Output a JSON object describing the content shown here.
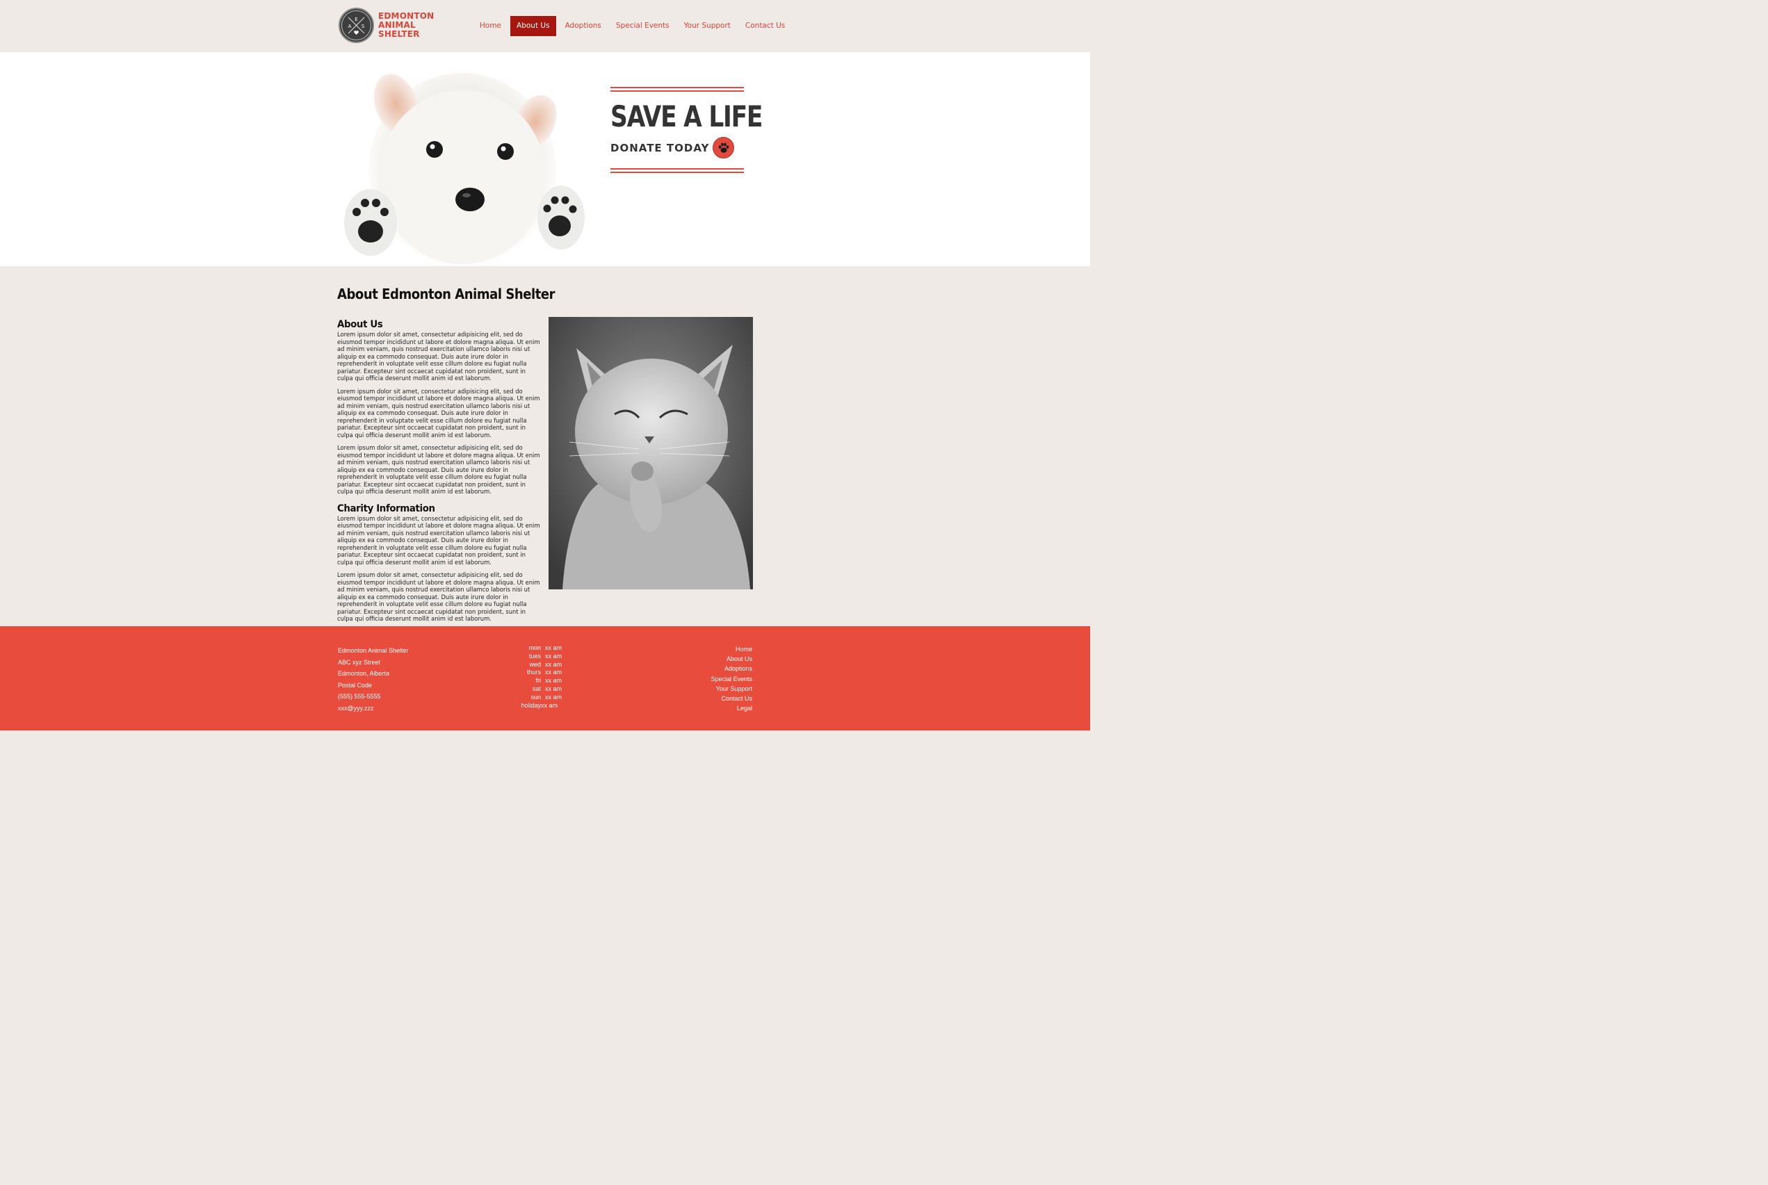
{
  "header": {
    "logo": {
      "badge_letters": [
        "E",
        "A",
        "S"
      ],
      "lines": [
        "EDMONTON",
        "ANIMAL",
        "SHELTER"
      ]
    },
    "nav": [
      {
        "label": "Home",
        "active": false
      },
      {
        "label": "About Us",
        "active": true
      },
      {
        "label": "Adoptions",
        "active": false
      },
      {
        "label": "Special Events",
        "active": false
      },
      {
        "label": "Your Support",
        "active": false
      },
      {
        "label": "Contact Us",
        "active": false
      }
    ]
  },
  "hero": {
    "title": "SAVE A LIFE",
    "cta": "DONATE TODAY",
    "cta_icon": "paw-icon"
  },
  "about": {
    "title": "About Edmonton Animal Shelter",
    "sections": [
      {
        "heading": "About Us",
        "paragraphs": [
          "Lorem ipsum dolor sit amet, consectetur adipisicing elit, sed do eiusmod tempor incididunt ut labore et dolore magna aliqua. Ut enim ad minim veniam, quis nostrud exercitation ullamco laboris nisi ut aliquip ex ea commodo consequat. Duis aute irure dolor in reprehenderit in voluptate velit esse cillum dolore eu fugiat nulla pariatur. Excepteur sint occaecat cupidatat non proident, sunt in culpa qui officia deserunt mollit anim id est laborum.",
          "Lorem ipsum dolor sit amet, consectetur adipisicing elit, sed do eiusmod tempor incididunt ut labore et dolore magna aliqua. Ut enim ad minim veniam, quis nostrud exercitation ullamco laboris nisi ut aliquip ex ea commodo consequat. Duis aute irure dolor in reprehenderit in voluptate velit esse cillum dolore eu fugiat nulla pariatur. Excepteur sint occaecat cupidatat non proident, sunt in culpa qui officia deserunt mollit anim id est laborum.",
          "Lorem ipsum dolor sit amet, consectetur adipisicing elit, sed do eiusmod tempor incididunt ut labore et dolore magna aliqua. Ut enim ad minim veniam, quis nostrud exercitation ullamco laboris nisi ut aliquip ex ea commodo consequat. Duis aute irure dolor in reprehenderit in voluptate velit esse cillum dolore eu fugiat nulla pariatur. Excepteur sint occaecat cupidatat non proident, sunt in culpa qui officia deserunt mollit anim id est laborum."
        ]
      },
      {
        "heading": "Charity Information",
        "paragraphs": [
          "Lorem ipsum dolor sit amet, consectetur adipisicing elit, sed do eiusmod tempor incididunt ut labore et dolore magna aliqua. Ut enim ad minim veniam, quis nostrud exercitation ullamco laboris nisi ut aliquip ex ea commodo consequat. Duis aute irure dolor in reprehenderit in voluptate velit esse cillum dolore eu fugiat nulla pariatur. Excepteur sint occaecat cupidatat non proident, sunt in culpa qui officia deserunt mollit anim id est laborum.",
          "Lorem ipsum dolor sit amet, consectetur adipisicing elit, sed do eiusmod tempor incididunt ut labore et dolore magna aliqua. Ut enim ad minim veniam, quis nostrud exercitation ullamco laboris nisi ut aliquip ex ea commodo consequat. Duis aute irure dolor in reprehenderit in voluptate velit esse cillum dolore eu fugiat nulla pariatur. Excepteur sint occaecat cupidatat non proident, sunt in culpa qui officia deserunt mollit anim id est laborum."
        ]
      }
    ]
  },
  "footer": {
    "address": [
      "Edmonton Animal Shelter",
      "ABC xyz Street",
      "Edmonton, Alberta",
      "Postal Code",
      "(555) 555-5555",
      "xxx@yyy.zzz"
    ],
    "hours": [
      {
        "day": "mon",
        "time": "xx am"
      },
      {
        "day": "tues",
        "time": "xx am"
      },
      {
        "day": "wed",
        "time": "xx am"
      },
      {
        "day": "thurs",
        "time": "xx am"
      },
      {
        "day": "fri",
        "time": "xx am"
      },
      {
        "day": "sat",
        "time": "xx am"
      },
      {
        "day": "sun",
        "time": "xx am"
      },
      {
        "day": "holiday",
        "time": "xx am"
      }
    ],
    "links": [
      "Home",
      "About Us",
      "Adoptions",
      "Special Events",
      "Your Support",
      "Contact Us",
      "Legal"
    ]
  },
  "colors": {
    "accent": "#e84c3d",
    "nav_active": "#a5170f",
    "page_bg": "#efeae5",
    "dark_text": "#333333"
  }
}
